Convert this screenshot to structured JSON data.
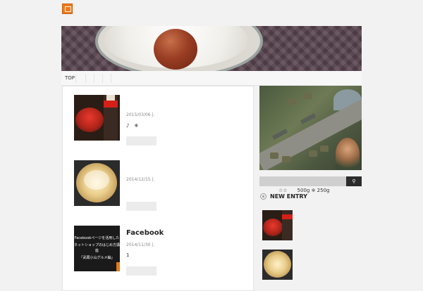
{
  "header": {
    "logo_icon": "site-logo-icon",
    "accent_color": "#ee7a1e"
  },
  "nav": {
    "items": [
      {
        "label": "TOP"
      }
    ]
  },
  "posts": [
    {
      "date": "2015/03/06 |.",
      "meta": "♪　❄",
      "title": ""
    },
    {
      "date": "2014/12/15 |.",
      "meta": "",
      "title": ""
    },
    {
      "date": "2014/11/30 |.",
      "meta": "1",
      "title": "Facebook",
      "thumb_lines": [
        "Facebookページを活用した",
        "ネットショップのはじめ方講座",
        "「武蔵小山グルメ編」"
      ]
    }
  ],
  "sidebar": {
    "search_button_icon": "search-icon",
    "promo_text": "☆☆　　500g ※ 250g",
    "section_title": "NEW ENTRY"
  }
}
